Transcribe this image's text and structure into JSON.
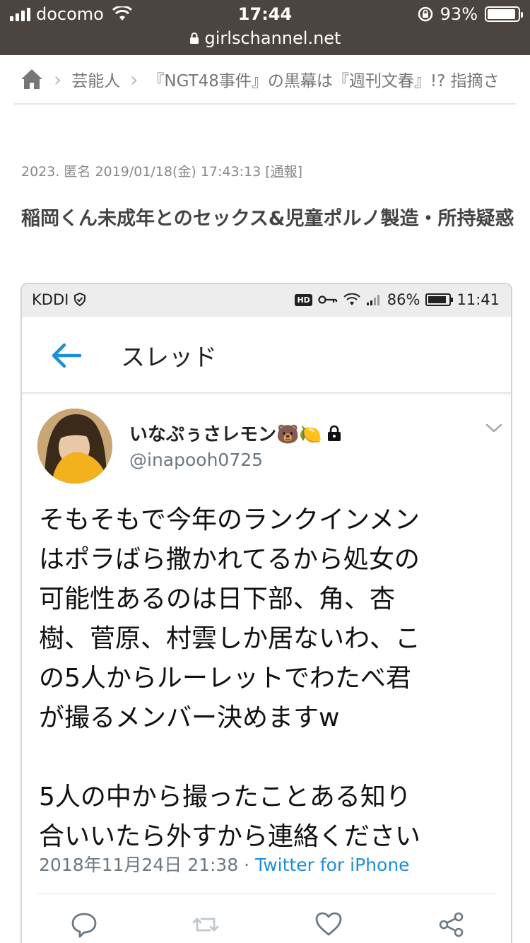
{
  "status_bar": {
    "carrier": "docomo",
    "time": "17:44",
    "battery": "93%",
    "url": "girlschannel.net"
  },
  "breadcrumb": {
    "home_icon": "home-icon",
    "items": [
      "芸能人",
      "『NGT48事件』の黒幕は『週刊文春』!? 指摘さ"
    ]
  },
  "comment": {
    "meta": "2023. 匿名 2019/01/18(金) 17:43:13",
    "report_link": "[通報]",
    "text": "稲岡くん未成年とのセックス&児童ポルノ製造・所持疑惑"
  },
  "embedded": {
    "status": {
      "carrier": "KDDI",
      "battery": "86%",
      "time": "11:41",
      "hd_label": "HD"
    },
    "header": {
      "title": "スレッド"
    },
    "tweet": {
      "display_name": "いなぷぅさレモン🐻🍋",
      "handle": "@inapooh0725",
      "body": "そもそもで今年のランクインメン\nはポラばら撒かれてるから処女の\n可能性あるのは日下部、角、杏\n樹、菅原、村雲しか居ないわ、こ\nの5人からルーレットでわたべ君\nが撮るメンバー決めますw\n\n5人の中から撮ったことある知り\n合いいたら外すから連絡ください",
      "timestamp": "2018年11月24日 21:38 · ",
      "via": "Twitter for iPhone"
    }
  },
  "colors": {
    "status_bg": "#4a4540",
    "twitter_blue": "#1d8fd8",
    "muted": "#6a7884"
  }
}
